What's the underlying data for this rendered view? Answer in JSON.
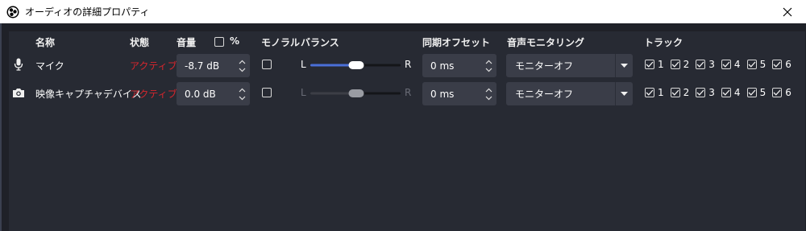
{
  "window": {
    "title": "オーディオの詳細プロパティ"
  },
  "headers": {
    "name": "名称",
    "status": "状態",
    "volume": "音量",
    "percent": "%",
    "mono": "モノラル",
    "balance": "バランス",
    "sync_offset": "同期オフセット",
    "monitoring": "音声モニタリング",
    "tracks": "トラック"
  },
  "rows": [
    {
      "icon": "microphone-icon",
      "name": "マイク",
      "status": "アクティブ",
      "volume": "-8.7 dB",
      "mono": false,
      "balance_left": "L",
      "balance_right": "R",
      "balance_value": 0.5,
      "balance_enabled": true,
      "sync_offset": "0 ms",
      "monitoring": "モニターオフ",
      "tracks": [
        "1",
        "2",
        "3",
        "4",
        "5",
        "6"
      ],
      "tracks_checked": [
        true,
        true,
        true,
        true,
        true,
        true
      ]
    },
    {
      "icon": "camera-icon",
      "name": "映像キャプチャデバイス",
      "status": "アクティブ",
      "volume": "0.0 dB",
      "mono": false,
      "balance_left": "L",
      "balance_right": "R",
      "balance_value": 0.5,
      "balance_enabled": false,
      "sync_offset": "0 ms",
      "monitoring": "モニターオフ",
      "tracks": [
        "1",
        "2",
        "3",
        "4",
        "5",
        "6"
      ],
      "tracks_checked": [
        true,
        true,
        true,
        true,
        true,
        true
      ]
    }
  ],
  "colors": {
    "status_active": "#d6262d",
    "slider_active": "#4a6fd8",
    "panel_bg": "#272a33",
    "input_bg": "#3a3d48"
  }
}
